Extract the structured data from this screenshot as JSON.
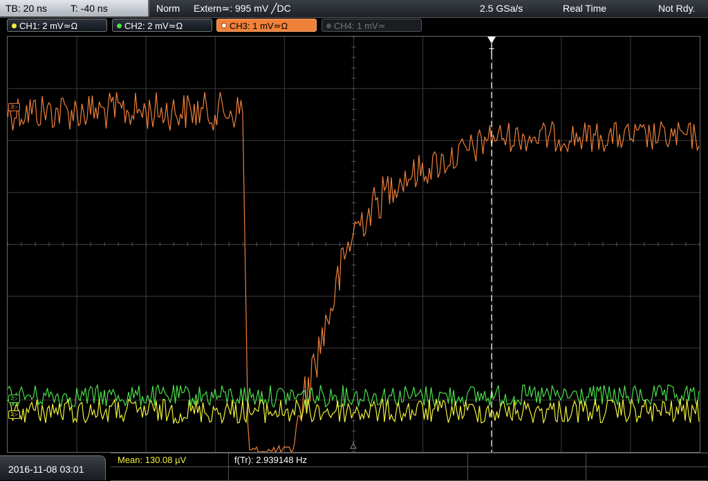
{
  "status": {
    "timebase": "TB: 20 ns",
    "trigger_offset": "T: -40 ns",
    "trigger_mode": "Norm",
    "trigger_source": "Extern≃: 995 mV ╱DC",
    "sample_rate": "2.5 GSa/s",
    "acq_mode": "Real Time",
    "state": "Not Rdy."
  },
  "channels": [
    {
      "label": "CH1: 2 mV≃Ω",
      "color": "#f2f23a",
      "state": "on"
    },
    {
      "label": "CH2: 2 mV≃Ω",
      "color": "#4be04b",
      "state": "on"
    },
    {
      "label": "CH3: 1 mV≃Ω",
      "color": "#f0813a",
      "state": "active"
    },
    {
      "label": "CH4: 1 mV≃",
      "color": "#777777",
      "state": "off"
    }
  ],
  "trigger_marker": "T",
  "ref_markers": {
    "ch1": "1▷",
    "ch2": "2▷",
    "ch3": "3▷"
  },
  "bottom": {
    "datetime": "2016-11-08 03:01",
    "measurements": [
      {
        "label": "Mean: 130.08 µV",
        "color": "#f2f23a"
      },
      {
        "label": "f(Tr): 2.939148 Hz",
        "color": "#ffffff"
      }
    ]
  },
  "colors": {
    "ch1": "#f2f23a",
    "ch2": "#4be04b",
    "ch3": "#f0813a",
    "grid": "#3c3c3c",
    "trigger": "#ffffff"
  }
}
